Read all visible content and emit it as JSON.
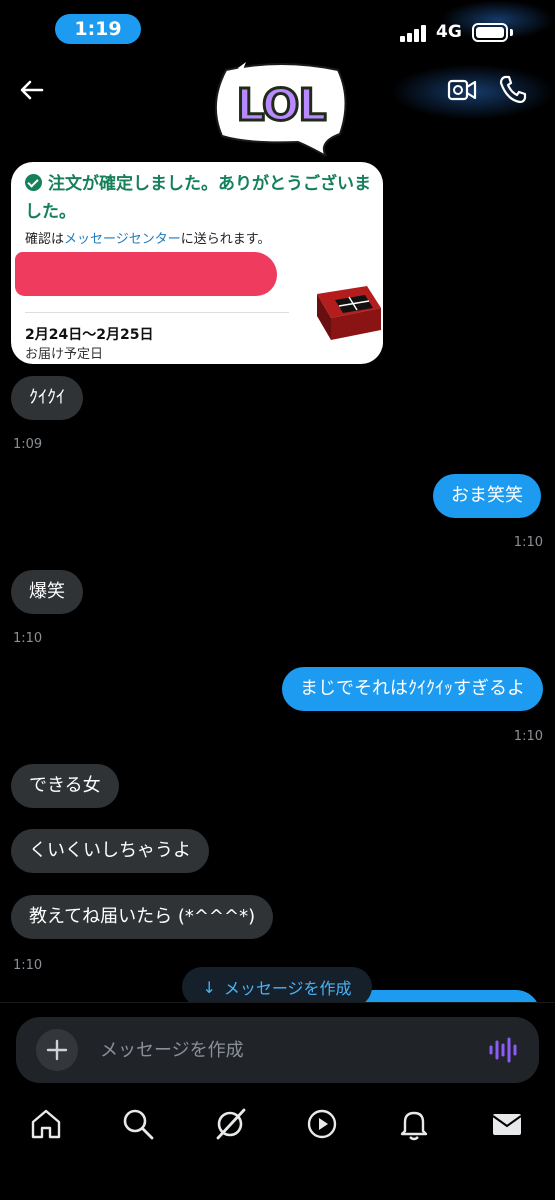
{
  "status_bar": {
    "time": "1:19",
    "network": "4G"
  },
  "header": {
    "sticker_text": "LOL"
  },
  "order_card": {
    "title": "注文が確定しました。ありがとうございました。",
    "subtitle_prefix": "確認は",
    "subtitle_link": "メッセージセンター",
    "subtitle_suffix": "に送られます。",
    "delivery_dates": "2月24日〜2月25日",
    "delivery_label": "お届け予定日"
  },
  "messages": [
    {
      "side": "received",
      "text": "ｸｲｸｲ",
      "time": "1:09"
    },
    {
      "side": "sent",
      "text": "おま笑笑",
      "time": "1:10"
    },
    {
      "side": "received",
      "text": "爆笑",
      "time": "1:10"
    },
    {
      "side": "sent",
      "text": "まじでそれはｸｲｸｲｯすぎるよ",
      "time": "1:10"
    },
    {
      "side": "received",
      "text": "できる女",
      "time": ""
    },
    {
      "side": "received",
      "text": "くいくいしちゃうよ",
      "time": ""
    },
    {
      "side": "received",
      "text": "教えてね届いたら (*^^^*)",
      "time": "1:10"
    }
  ],
  "compose_pill": {
    "label": "メッセージを作成"
  },
  "input": {
    "placeholder": "メッセージを作成"
  },
  "tabs": [
    "home",
    "search",
    "grok",
    "video",
    "notifications",
    "messages"
  ],
  "colors": {
    "accent": "#1d9bf0",
    "received_bubble": "#2f3336",
    "confirm_green": "#15805a",
    "voice_purple": "#8b5cf6"
  }
}
